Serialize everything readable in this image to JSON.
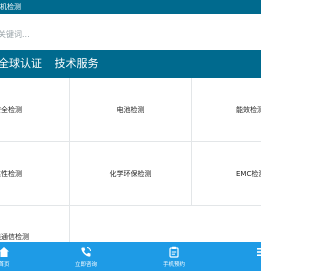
{
  "header": {
    "title": "机检测"
  },
  "search": {
    "placeholder": "关键词..."
  },
  "banner": {
    "item1": "全球认证",
    "item2": "技术服务"
  },
  "grid": {
    "cells": [
      "安全检测",
      "电池检测",
      "能效检测",
      "靠性检测",
      "化学环保检测",
      "EMC检测",
      "线通信检测"
    ]
  },
  "bottom_nav": {
    "items": [
      {
        "label": "首页",
        "icon": "home-icon"
      },
      {
        "label": "立即咨询",
        "icon": "phone-icon"
      },
      {
        "label": "手机预约",
        "icon": "calendar-icon"
      },
      {
        "label": "",
        "icon": "menu-icon"
      }
    ]
  },
  "colors": {
    "primary": "#006a8e",
    "nav": "#1e9be6",
    "divider": "#e3e6e8"
  }
}
